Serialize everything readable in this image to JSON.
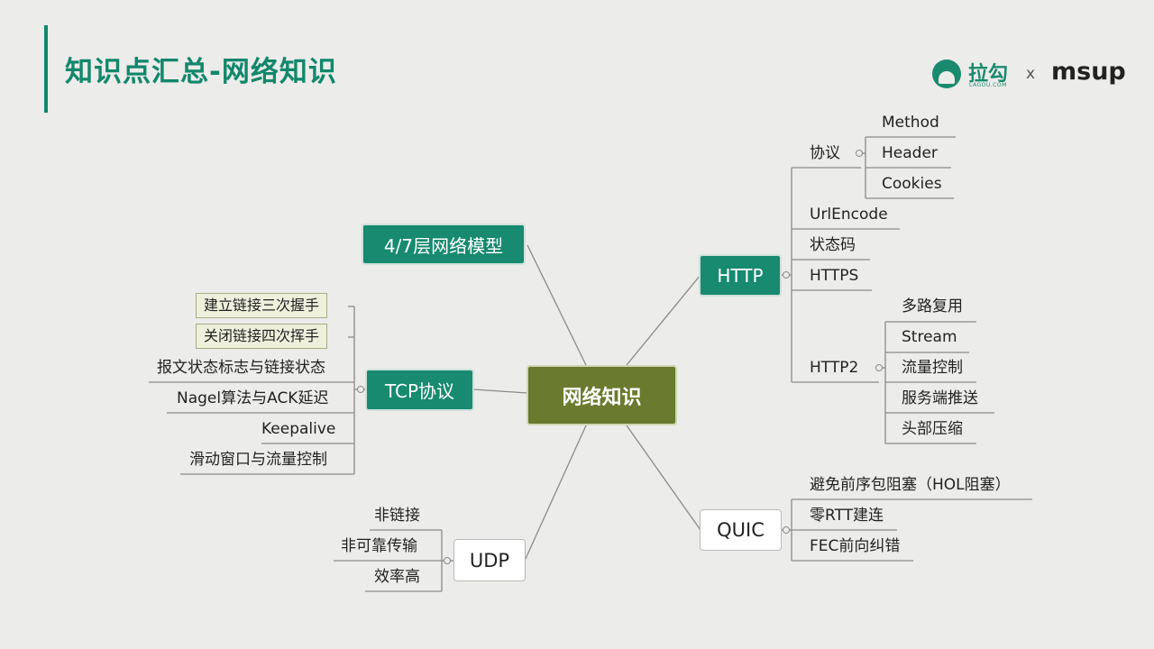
{
  "title": "知识点汇总-网络知识",
  "logo": {
    "name": "拉勾",
    "sub": "LAGOU.COM",
    "x": "x",
    "partner": "msup"
  },
  "center": "网络知识",
  "nodes": {
    "model": "4/7层网络模型",
    "tcp": "TCP协议",
    "udp": "UDP",
    "http": "HTTP",
    "quic": "QUIC"
  },
  "http": {
    "protocol": {
      "label": "协议",
      "children": [
        "Method",
        "Header",
        "Cookies"
      ]
    },
    "urlencode": "UrlEncode",
    "status": "状态码",
    "https": "HTTPS",
    "http2": {
      "label": "HTTP2",
      "children": [
        "多路复用",
        "Stream",
        "流量控制",
        "服务端推送",
        "头部压缩"
      ]
    }
  },
  "tcp_items": [
    "建立链接三次握手",
    "关闭链接四次挥手",
    "报文状态标志与链接状态",
    "Nagel算法与ACK延迟",
    "Keepalive",
    "滑动窗口与流量控制"
  ],
  "udp_items": [
    "非链接",
    "非可靠传输",
    "效率高"
  ],
  "quic_items": [
    "避免前序包阻塞（HOL阻塞）",
    "零RTT建连",
    "FEC前向纠错"
  ]
}
